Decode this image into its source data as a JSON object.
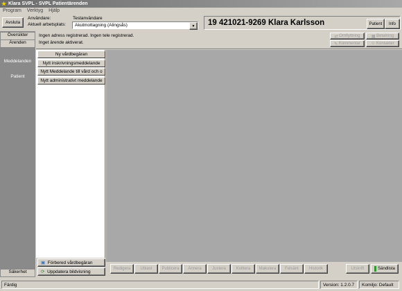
{
  "window": {
    "title": "Klara SVPL - SVPL Patientärenden"
  },
  "menubar": {
    "items": [
      "Program",
      "Verktyg",
      "Hjälp"
    ]
  },
  "toolbar": {
    "avsluta_label": "Avsluta",
    "user_label": "Användare:",
    "workplace_label": "Aktuell arbetsplats:",
    "test_user_label": "Testanvändare",
    "workplace_value": "Akutmottagning (Alingsås)",
    "patient_id": "19 421021-9269 Klara Karlsson",
    "patient_button": "Patient",
    "info_button": "Info"
  },
  "sidebar": {
    "tabs": [
      {
        "label": "Översikter"
      },
      {
        "label": "Ärenden"
      },
      {
        "label": "Meddelanden"
      },
      {
        "label": "Patient"
      }
    ],
    "bottom_tab": "Säkerhet"
  },
  "info": {
    "line1": "Ingen adress registrerad.  Ingen tele registrerad.",
    "line2": "Inget ärende aktiverat."
  },
  "right_actions": {
    "omflyttning": "Omflyttning",
    "betalning": "Betalning",
    "kommentar": "Kommentar",
    "kontakter": "Kontakter"
  },
  "new_menu": {
    "items": [
      "Ny vårdbegäran",
      "Nytt inskrivningsmeddelande",
      "Nytt Meddelande till vård och o",
      "Nytt administrativt meddelande"
    ]
  },
  "left_bottom": {
    "forbered": "Förbered vårdbegäran",
    "uppdatera": "Uppdatera bildvisning"
  },
  "action_bar": {
    "buttons": [
      "Redigera",
      "Utkast",
      "Publicera",
      "Annera",
      "Justera",
      "Kvittera",
      "Makulera",
      "Felsänt",
      "Historik"
    ],
    "utskrift": "Utskrift",
    "sandlista": "Sändlista"
  },
  "status": {
    "left": "Färdig",
    "version": "Version: 1.2.0.7",
    "komiljo": "Komiljo: Default"
  },
  "colors": {
    "sandlista_icon": "#2a9a2a"
  }
}
